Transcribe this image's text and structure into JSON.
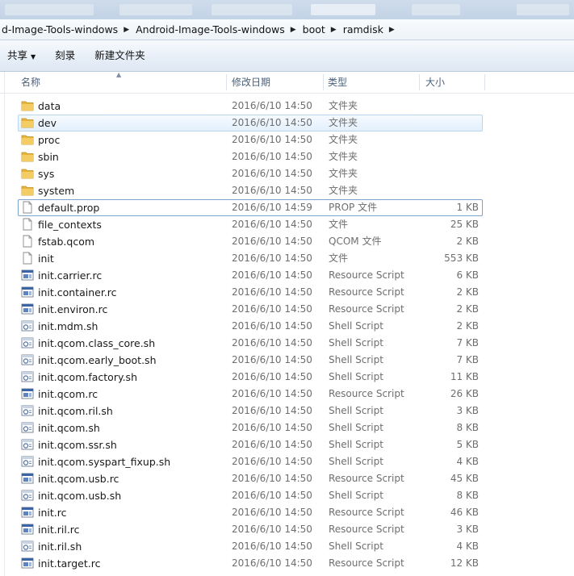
{
  "breadcrumb": [
    "d-Image-Tools-windows",
    "Android-Image-Tools-windows",
    "boot",
    "ramdisk"
  ],
  "toolbar": {
    "share": "共享",
    "burn": "刻录",
    "new_folder": "新建文件夹"
  },
  "columns": {
    "name": "名称",
    "date": "修改日期",
    "type": "类型",
    "size": "大小"
  },
  "files": [
    {
      "name": "data",
      "date": "2016/6/10 14:50",
      "type": "文件夹",
      "size": "",
      "icon": "folder-icon"
    },
    {
      "name": "dev",
      "date": "2016/6/10 14:50",
      "type": "文件夹",
      "size": "",
      "icon": "folder-icon"
    },
    {
      "name": "proc",
      "date": "2016/6/10 14:50",
      "type": "文件夹",
      "size": "",
      "icon": "folder-icon"
    },
    {
      "name": "sbin",
      "date": "2016/6/10 14:50",
      "type": "文件夹",
      "size": "",
      "icon": "folder-icon"
    },
    {
      "name": "sys",
      "date": "2016/6/10 14:50",
      "type": "文件夹",
      "size": "",
      "icon": "folder-icon"
    },
    {
      "name": "system",
      "date": "2016/6/10 14:50",
      "type": "文件夹",
      "size": "",
      "icon": "folder-icon"
    },
    {
      "name": "default.prop",
      "date": "2016/6/10 14:59",
      "type": "PROP 文件",
      "size": "1 KB",
      "icon": "file-icon"
    },
    {
      "name": "file_contexts",
      "date": "2016/6/10 14:50",
      "type": "文件",
      "size": "25 KB",
      "icon": "file-icon"
    },
    {
      "name": "fstab.qcom",
      "date": "2016/6/10 14:50",
      "type": "QCOM 文件",
      "size": "2 KB",
      "icon": "file-icon"
    },
    {
      "name": "init",
      "date": "2016/6/10 14:50",
      "type": "文件",
      "size": "553 KB",
      "icon": "file-icon"
    },
    {
      "name": "init.carrier.rc",
      "date": "2016/6/10 14:50",
      "type": "Resource Script",
      "size": "6 KB",
      "icon": "resource-script-icon"
    },
    {
      "name": "init.container.rc",
      "date": "2016/6/10 14:50",
      "type": "Resource Script",
      "size": "2 KB",
      "icon": "resource-script-icon"
    },
    {
      "name": "init.environ.rc",
      "date": "2016/6/10 14:50",
      "type": "Resource Script",
      "size": "2 KB",
      "icon": "resource-script-icon"
    },
    {
      "name": "init.mdm.sh",
      "date": "2016/6/10 14:50",
      "type": "Shell Script",
      "size": "2 KB",
      "icon": "shell-script-icon"
    },
    {
      "name": "init.qcom.class_core.sh",
      "date": "2016/6/10 14:50",
      "type": "Shell Script",
      "size": "7 KB",
      "icon": "shell-script-icon"
    },
    {
      "name": "init.qcom.early_boot.sh",
      "date": "2016/6/10 14:50",
      "type": "Shell Script",
      "size": "7 KB",
      "icon": "shell-script-icon"
    },
    {
      "name": "init.qcom.factory.sh",
      "date": "2016/6/10 14:50",
      "type": "Shell Script",
      "size": "11 KB",
      "icon": "shell-script-icon"
    },
    {
      "name": "init.qcom.rc",
      "date": "2016/6/10 14:50",
      "type": "Resource Script",
      "size": "26 KB",
      "icon": "resource-script-icon"
    },
    {
      "name": "init.qcom.ril.sh",
      "date": "2016/6/10 14:50",
      "type": "Shell Script",
      "size": "3 KB",
      "icon": "shell-script-icon"
    },
    {
      "name": "init.qcom.sh",
      "date": "2016/6/10 14:50",
      "type": "Shell Script",
      "size": "8 KB",
      "icon": "shell-script-icon"
    },
    {
      "name": "init.qcom.ssr.sh",
      "date": "2016/6/10 14:50",
      "type": "Shell Script",
      "size": "5 KB",
      "icon": "shell-script-icon"
    },
    {
      "name": "init.qcom.syspart_fixup.sh",
      "date": "2016/6/10 14:50",
      "type": "Shell Script",
      "size": "4 KB",
      "icon": "shell-script-icon"
    },
    {
      "name": "init.qcom.usb.rc",
      "date": "2016/6/10 14:50",
      "type": "Resource Script",
      "size": "45 KB",
      "icon": "resource-script-icon"
    },
    {
      "name": "init.qcom.usb.sh",
      "date": "2016/6/10 14:50",
      "type": "Shell Script",
      "size": "8 KB",
      "icon": "shell-script-icon"
    },
    {
      "name": "init.rc",
      "date": "2016/6/10 14:50",
      "type": "Resource Script",
      "size": "46 KB",
      "icon": "resource-script-icon"
    },
    {
      "name": "init.ril.rc",
      "date": "2016/6/10 14:50",
      "type": "Resource Script",
      "size": "3 KB",
      "icon": "resource-script-icon"
    },
    {
      "name": "init.ril.sh",
      "date": "2016/6/10 14:50",
      "type": "Shell Script",
      "size": "4 KB",
      "icon": "shell-script-icon"
    },
    {
      "name": "init.target.rc",
      "date": "2016/6/10 14:50",
      "type": "Resource Script",
      "size": "12 KB",
      "icon": "resource-script-icon"
    }
  ],
  "hover_row": "dev",
  "focus_row": "default.prop",
  "colors": {
    "folder": "#e8b63a",
    "selection_border": "#7da2ce",
    "hover_fill": "#e3f0fc"
  }
}
